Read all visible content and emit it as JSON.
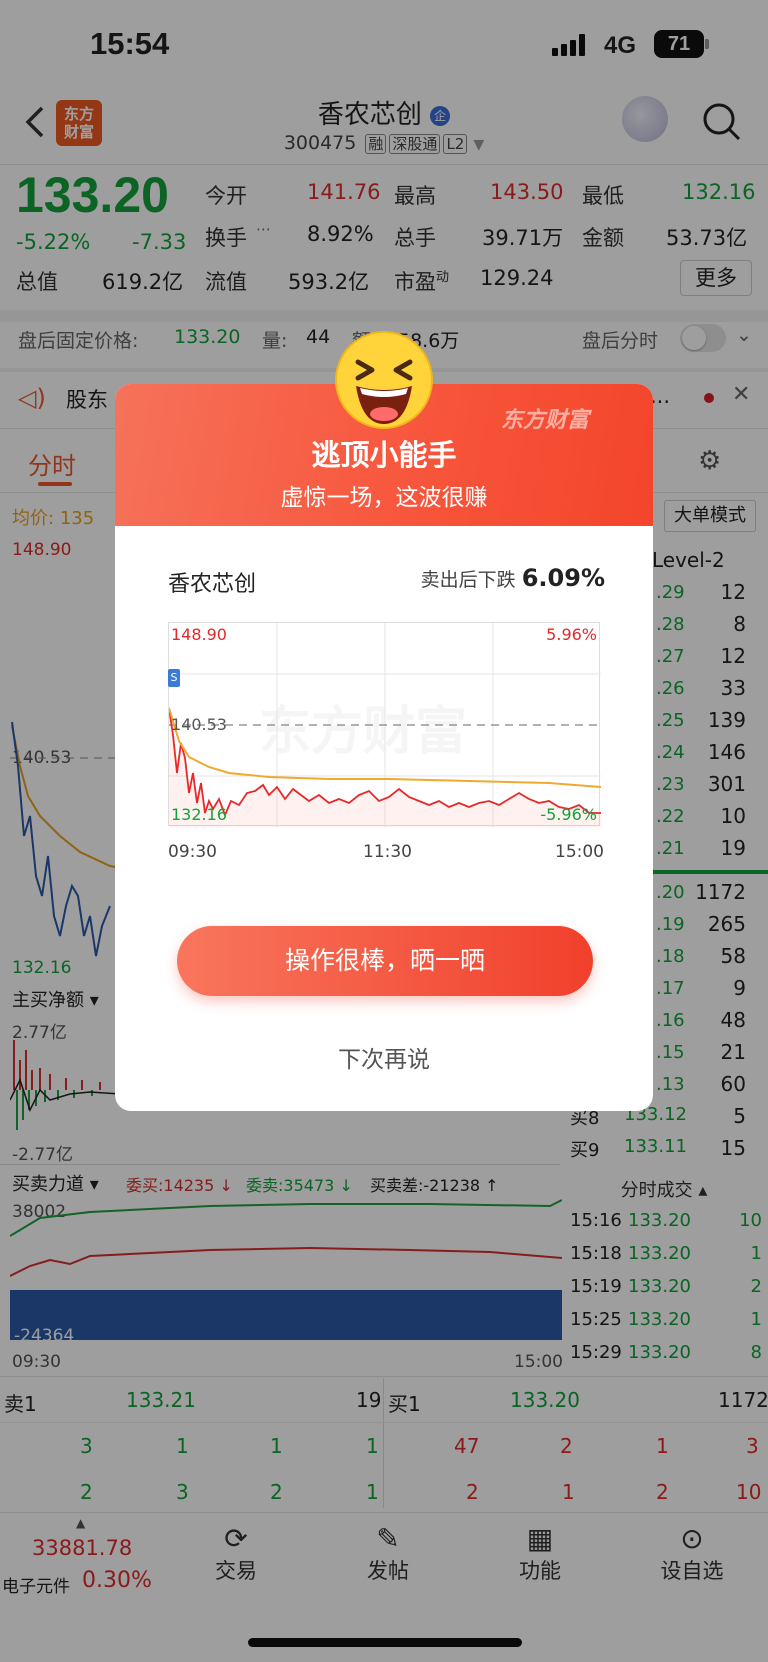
{
  "status": {
    "time": "15:54",
    "network": "4G",
    "battery": "71"
  },
  "header": {
    "title": "香农芯创",
    "title_badge": "企",
    "code": "300475",
    "tags": [
      "融",
      "深股通",
      "L2"
    ],
    "logo_line1": "东方",
    "logo_line2": "财富"
  },
  "quote": {
    "price": "133.20",
    "change_pct": "-5.22%",
    "change": "-7.33",
    "row1": [
      {
        "label": "今开",
        "value": "141.76"
      },
      {
        "label": "最高",
        "value": "143.50"
      },
      {
        "label": "最低",
        "value": "132.16"
      }
    ],
    "row2": [
      {
        "label": "换手",
        "value": "8.92%"
      },
      {
        "label": "总手",
        "value": "39.71万"
      },
      {
        "label": "金额",
        "value": "53.73亿"
      }
    ],
    "row3": [
      {
        "label": "总值",
        "value": "619.2亿"
      },
      {
        "label": "流值",
        "value": "593.2亿"
      },
      {
        "label": "市盈",
        "sup": "动",
        "value": "129.24"
      }
    ],
    "more": "更多"
  },
  "afterhours": {
    "label": "盘后固定价格:",
    "price": "133.20",
    "vol_label": "量:",
    "vol": "44",
    "amt_label": "额",
    "amt": "58.6万",
    "toggle_label": "盘后分时"
  },
  "notice": {
    "text": "股东",
    "dots": "..."
  },
  "tabs": {
    "active": "分时"
  },
  "chart_bg": {
    "avg_label": "均价:",
    "avg_val": "135",
    "top": "148.90",
    "mid": "140.53",
    "bottom": "132.16",
    "net_label": "主买净额",
    "net_top": "2.77亿",
    "net_bottom": "-2.77亿",
    "force_label": "买卖力道",
    "wei_buy": "委买:14235 ↓",
    "wei_sell": "委卖:35473 ↓",
    "diff": "买卖差:-21238 ↑",
    "force_top": "38002",
    "force_bottom": "-24364",
    "t_start": "09:30",
    "t_end": "15:00",
    "big_mode": "大单模式",
    "level2": "Level-2"
  },
  "orderbook_right": {
    "sell": [
      [
        ".29",
        "12"
      ],
      [
        ".28",
        "8"
      ],
      [
        ".27",
        "12"
      ],
      [
        ".26",
        "33"
      ],
      [
        ".25",
        "139"
      ],
      [
        ".24",
        "146"
      ],
      [
        ".23",
        "301"
      ],
      [
        ".22",
        "10"
      ],
      [
        ".21",
        "19"
      ]
    ],
    "buy": [
      [
        ".20",
        "1172"
      ],
      [
        ".19",
        "265"
      ],
      [
        ".18",
        "58"
      ],
      [
        ".17",
        "9"
      ],
      [
        ".16",
        "48"
      ],
      [
        ".15",
        "21"
      ],
      [
        ".13",
        "60"
      ]
    ],
    "buy_full": [
      {
        "label": "买8",
        "price": "133.12",
        "vol": "5"
      },
      {
        "label": "买9",
        "price": "133.11",
        "vol": "15"
      }
    ]
  },
  "trades": {
    "title": "分时成交",
    "rows": [
      [
        "15:16",
        "133.20",
        "10"
      ],
      [
        "15:18",
        "133.20",
        "1"
      ],
      [
        "15:19",
        "133.20",
        "2"
      ],
      [
        "15:25",
        "133.20",
        "1"
      ],
      [
        "15:29",
        "133.20",
        "8"
      ]
    ]
  },
  "bottom_book": {
    "sell1": {
      "label": "卖1",
      "price": "133.21",
      "vol": "19"
    },
    "buy1": {
      "label": "买1",
      "price": "133.20",
      "vol": "1172"
    },
    "left_rows": [
      [
        "3",
        "1",
        "1",
        "1"
      ],
      [
        "2",
        "3",
        "2",
        "1"
      ]
    ],
    "right_rows": [
      [
        "47",
        "2",
        "1",
        "3"
      ],
      [
        "2",
        "1",
        "2",
        "10"
      ]
    ]
  },
  "bottom_nav": {
    "index_value": "33881.78",
    "index_name": "电子元件",
    "index_pct": "0.30%",
    "items": [
      "交易",
      "发帖",
      "功能",
      "设自选"
    ]
  },
  "dialog": {
    "title": "逃顶小能手",
    "subtitle": "虚惊一场，这波很赚",
    "brand": "东方财富",
    "stock_name": "香农芯创",
    "drop_label": "卖出后下跌",
    "drop_value": "6.09%",
    "chart": {
      "top_price": "148.90",
      "top_pct": "5.96%",
      "mid": "140.53",
      "bottom_price": "132.16",
      "bottom_pct": "-5.96%",
      "times": [
        "09:30",
        "11:30",
        "15:00"
      ],
      "watermark": "东方财富"
    },
    "share_button": "操作很棒，晒一晒",
    "later_button": "下次再说"
  },
  "colors": {
    "up": "#e02a2a",
    "down": "#13a23a",
    "brand": "#f5553a"
  }
}
